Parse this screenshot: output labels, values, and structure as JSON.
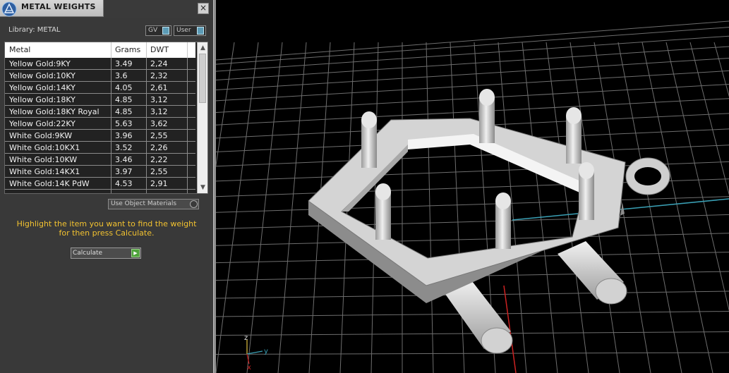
{
  "panel": {
    "title": "METAL WEIGHTS",
    "close_icon": "×",
    "library_label": "Library: METAL",
    "toggles": [
      {
        "label": "GV",
        "state": "I"
      },
      {
        "label": "User",
        "state": "I"
      }
    ],
    "table": {
      "columns": [
        "Metal",
        "Grams",
        "DWT"
      ],
      "rows": [
        [
          "Yellow Gold:9KY",
          "3.49",
          "2,24"
        ],
        [
          "Yellow Gold:10KY",
          "3.6",
          "2,32"
        ],
        [
          "Yellow Gold:14KY",
          "4.05",
          "2,61"
        ],
        [
          "Yellow Gold:18KY",
          "4.85",
          "3,12"
        ],
        [
          "Yellow Gold:18KY Royal",
          "4.85",
          "3,12"
        ],
        [
          "Yellow Gold:22KY",
          "5.63",
          "3,62"
        ],
        [
          "White Gold:9KW",
          "3.96",
          "2,55"
        ],
        [
          "White Gold:10KX1",
          "3.52",
          "2,26"
        ],
        [
          "White Gold:10KW",
          "3.46",
          "2,22"
        ],
        [
          "White Gold:14KX1",
          "3.97",
          "2,55"
        ],
        [
          "White Gold:14K PdW",
          "4.53",
          "2,91"
        ]
      ],
      "scroll_up_icon": "▲",
      "scroll_down_icon": "▼"
    },
    "use_object_materials": "Use Object Materials",
    "help_text_line1": "Highlight the item you want to find the weight",
    "help_text_line2": "for then press Calculate.",
    "calculate_label": "Calculate",
    "calculate_go_icon": "▶"
  },
  "viewport": {
    "axis_z": "z",
    "axis_y": "y",
    "axis_x": "x"
  },
  "colors": {
    "panel_bg": "#393939",
    "highlight_text": "#f2c230",
    "grid_line": "#6e6e6e",
    "axis_x": "#cc2222",
    "axis_y": "#3aa0b5",
    "model": "#d9d9d9"
  }
}
